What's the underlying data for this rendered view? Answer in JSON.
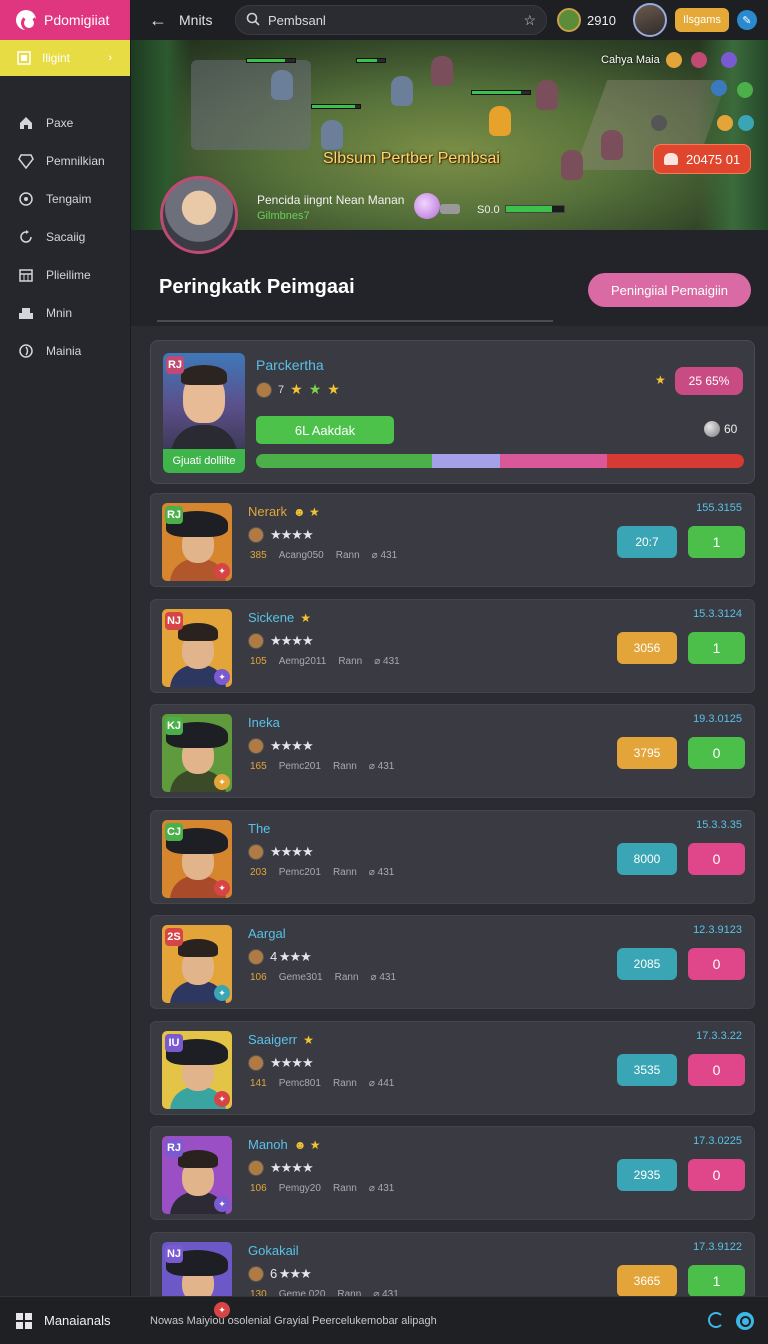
{
  "brand": {
    "name": "Pdomigiiat"
  },
  "sidebar": {
    "active": {
      "label": "Iligint",
      "icon": "rank-icon"
    },
    "items": [
      {
        "label": "Paxe",
        "icon": "home-icon"
      },
      {
        "label": "Pemnilkian",
        "icon": "gem-icon"
      },
      {
        "label": "Tengaim",
        "icon": "compass-icon"
      },
      {
        "label": "Sacaiig",
        "icon": "sync-icon"
      },
      {
        "label": "Plieilime",
        "icon": "calendar-icon"
      },
      {
        "label": "Mnin",
        "icon": "people-icon"
      },
      {
        "label": "Mainia",
        "icon": "swirl-icon"
      }
    ]
  },
  "topbar": {
    "title": "Mnits",
    "search_value": "Pembsanl",
    "coins": "2910",
    "badge": "Ilsgams"
  },
  "banner": {
    "caption": "Cahya Maia",
    "title": "Slbsum Pertber Pembsai",
    "score": "20475 01",
    "hero_name": "Pencida iingnt Nean Manan",
    "hero_sub": "Gilmbnes7",
    "hero_score": "S0.0"
  },
  "section": {
    "title": "Peringkatk Peimgaai",
    "button": "Peningiial Pemaigiin"
  },
  "featured": {
    "rank": "RJ",
    "name": "Parckertha",
    "level": "7",
    "label": "Gjuati dollilte",
    "action": "6L Aakdak",
    "percent": "25 65%",
    "coin": "60",
    "progress": [
      {
        "color": "#4cb04a",
        "fraction": 0.36
      },
      {
        "color": "#a5a1e8",
        "fraction": 0.14
      },
      {
        "color": "#d9589a",
        "fraction": 0.22
      },
      {
        "color": "#d73a34",
        "fraction": 0.28
      }
    ]
  },
  "players": [
    {
      "rank": "RJ",
      "rank_color": "#4cb04a",
      "name": "Nerark",
      "name_color": "#e3a53a",
      "badges": "☻ ★",
      "stars": "★★★★",
      "stat_n": "385",
      "stat_a": "Acang050",
      "stat_b": "Rann",
      "stat_c": "⌀ 431",
      "time": "155.3155",
      "b1": "20:7",
      "b1_color": "#3aa5b4",
      "b2": "1",
      "b2_color": "#4cbf4a",
      "bg": "#d6862e",
      "hat": true,
      "body": "#b2562c",
      "badge_color": "#d64545"
    },
    {
      "rank": "NJ",
      "rank_color": "#d64545",
      "name": "Sickene",
      "name_color": "#58c1e8",
      "badges": "★",
      "stars": "★★★★",
      "stat_n": "105",
      "stat_a": "Aemg2011",
      "stat_b": "Rann",
      "stat_c": "⌀ 431",
      "time": "15.3.3124",
      "b1": "3056",
      "b1_color": "#e3a53a",
      "b2": "1",
      "b2_color": "#4cbf4a",
      "bg": "#e3a53a",
      "hat": false,
      "body": "#2e3760",
      "badge_color": "#7a5ad0"
    },
    {
      "rank": "KJ",
      "rank_color": "#4cb04a",
      "name": "Ineka",
      "name_color": "#58c1e8",
      "badges": "",
      "stars": "★★★★",
      "stat_n": "165",
      "stat_a": "Pemc201",
      "stat_b": "Rann",
      "stat_c": "⌀ 431",
      "time": "19.3.0125",
      "b1": "3795",
      "b1_color": "#e3a53a",
      "b2": "0",
      "b2_color": "#4cbf4a",
      "bg": "#5f9a3c",
      "hat": true,
      "body": "#3b4b28",
      "badge_color": "#e3a53a"
    },
    {
      "rank": "CJ",
      "rank_color": "#4cb04a",
      "name": "The",
      "name_color": "#58c1e8",
      "badges": "",
      "stars": "★★★★",
      "stat_n": "203",
      "stat_a": "Pemc201",
      "stat_b": "Rann",
      "stat_c": "⌀ 431",
      "time": "15.3.3.35",
      "b1": "8000",
      "b1_color": "#3aa5b4",
      "b2": "0",
      "b2_color": "#e0468a",
      "bg": "#d6862e",
      "hat": true,
      "body": "#a94a2a",
      "badge_color": "#d64545"
    },
    {
      "rank": "2S",
      "rank_color": "#d64545",
      "name": "Aargal",
      "name_color": "#58c1e8",
      "badges": "",
      "stars": "4 ★★★",
      "stat_n": "106",
      "stat_a": "Geme301",
      "stat_b": "Rann",
      "stat_c": "⌀ 431",
      "time": "12.3.9123",
      "b1": "2085",
      "b1_color": "#3aa5b4",
      "b2": "0",
      "b2_color": "#e0468a",
      "bg": "#e3a53a",
      "hat": false,
      "body": "#2e3760",
      "badge_color": "#3aa5b4"
    },
    {
      "rank": "IU",
      "rank_color": "#7a5ad0",
      "name": "Saaigerr",
      "name_color": "#58c1e8",
      "badges": "★",
      "stars": "★★★★",
      "stat_n": "141",
      "stat_a": "Pemc801",
      "stat_b": "Rann",
      "stat_c": "⌀ 441",
      "time": "17.3.3.22",
      "b1": "3535",
      "b1_color": "#3aa5b4",
      "b2": "0",
      "b2_color": "#e0468a",
      "bg": "#e3c447",
      "hat": true,
      "body": "#3aa5a0",
      "badge_color": "#d64545"
    },
    {
      "rank": "RJ",
      "rank_color": "#7a5ad0",
      "name": "Manoh",
      "name_color": "#58c1e8",
      "badges": "☻ ★",
      "stars": "★★★★",
      "stat_n": "106",
      "stat_a": "Pemgy20",
      "stat_b": "Rann",
      "stat_c": "⌀ 431",
      "time": "17.3.0225",
      "b1": "2935",
      "b1_color": "#3aa5b4",
      "b2": "0",
      "b2_color": "#e0468a",
      "bg": "#9a4fc4",
      "hat": false,
      "body": "#2d2a36",
      "badge_color": "#7a5ad0"
    },
    {
      "rank": "NJ",
      "rank_color": "#7a5ad0",
      "name": "Gokakail",
      "name_color": "#58c1e8",
      "badges": "",
      "stars": "6 ★★★",
      "stat_n": "130",
      "stat_a": "Geme 020",
      "stat_b": "Rann",
      "stat_c": "⌀ 431",
      "time": "17.3.9122",
      "b1": "3665",
      "b1_color": "#e3a53a",
      "b2": "1",
      "b2_color": "#4cbf4a",
      "bg": "#6d58c8",
      "hat": true,
      "body": "#3b3b46",
      "badge_color": "#d64545"
    }
  ],
  "bottombar": {
    "label": "Manaianals",
    "message": "Nowas Maiyiou osolenial Grayial Peercelukemobar alipagh"
  }
}
